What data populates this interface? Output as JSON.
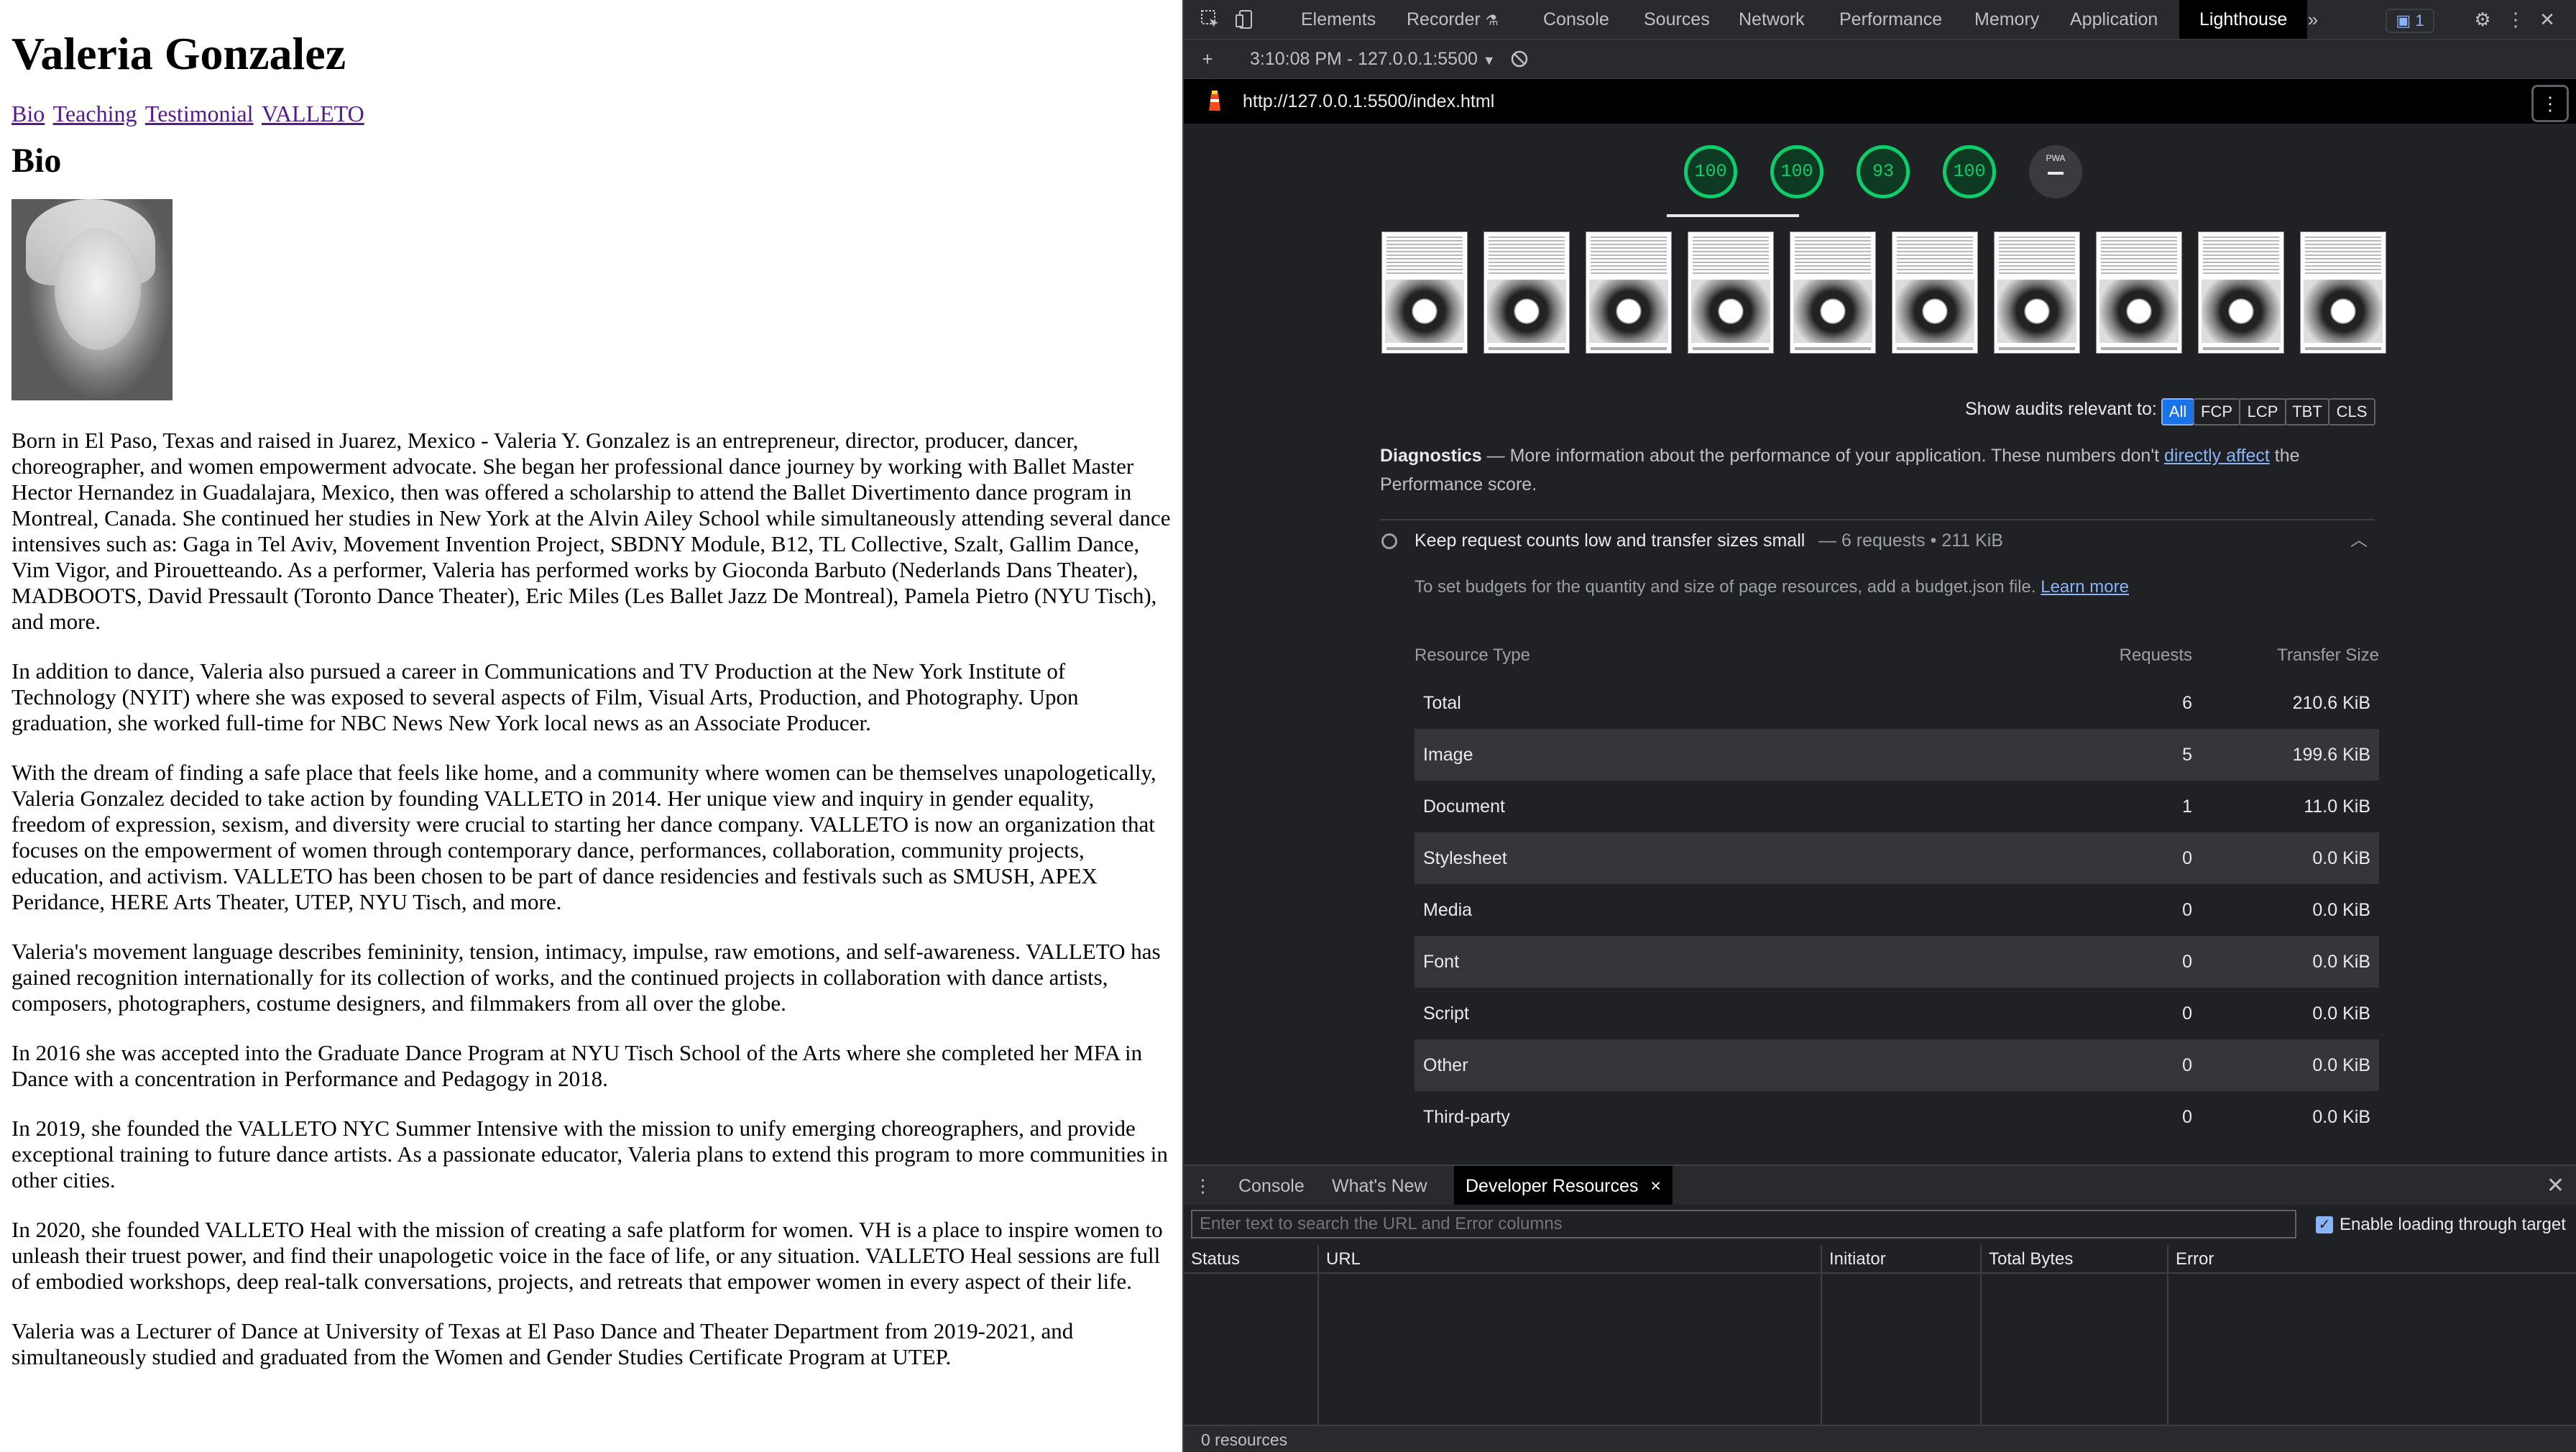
{
  "page": {
    "title": "Valeria Gonzalez",
    "nav": [
      "Bio",
      "Teaching",
      "Testimonial",
      "VALLETO"
    ],
    "section_heading": "Bio",
    "paragraphs": [
      "Born in El Paso, Texas and raised in Juarez, Mexico - Valeria Y. Gonzalez is an entrepreneur, director, producer, dancer, choreographer, and women empowerment advocate. She began her professional dance journey by working with Ballet Master Hector Hernandez in Guadalajara, Mexico, then was offered a scholarship to attend the Ballet Divertimento dance program in Montreal, Canada. She continued her studies in New York at the Alvin Ailey School while simultaneously attending several dance intensives such as: Gaga in Tel Aviv, Movement Invention Project, SBDNY Module, B12, TL Collective, Szalt, Gallim Dance, Vim Vigor, and Pirouetteando. As a performer, Valeria has performed works by Gioconda Barbuto (Nederlands Dans Theater), MADBOOTS, David Pressault (Toronto Dance Theater), Eric Miles (Les Ballet Jazz De Montreal), Pamela Pietro (NYU Tisch), and more.",
      "In addition to dance, Valeria also pursued a career in Communications and TV Production at the New York Institute of Technology (NYIT) where she was exposed to several aspects of Film, Visual Arts, Production, and Photography. Upon graduation, she worked full-time for NBC News New York local news as an Associate Producer.",
      "With the dream of finding a safe place that feels like home, and a community where women can be themselves unapologetically, Valeria Gonzalez decided to take action by founding VALLETO in 2014. Her unique view and inquiry in gender equality, freedom of expression, sexism, and diversity were crucial to starting her dance company. VALLETO is now an organization that focuses on the empowerment of women through contemporary dance, performances, collaboration, community projects, education, and activism. VALLETO has been chosen to be part of dance residencies and festivals such as SMUSH, APEX Peridance, HERE Arts Theater, UTEP, NYU Tisch, and more.",
      "Valeria's movement language describes femininity, tension, intimacy, impulse, raw emotions, and self-awareness. VALLETO has gained recognition internationally for its collection of works, and the continued projects in collaboration with dance artists, composers, photographers, costume designers, and filmmakers from all over the globe.",
      "In 2016 she was accepted into the Graduate Dance Program at NYU Tisch School of the Arts where she completed her MFA in Dance with a concentration in Performance and Pedagogy in 2018.",
      "In 2019, she founded the VALLETO NYC Summer Intensive with the mission to unify emerging choreographers, and provide exceptional training to future dance artists. As a passionate educator, Valeria plans to extend this program to more communities in other cities.",
      "In 2020, she founded VALLETO Heal with the mission of creating a safe platform for women. VH is a place to inspire women to unleash their truest power, and find their unapologetic voice in the face of life, or any situation. VALLETO Heal sessions are full of embodied workshops, deep real-talk conversations, projects, and retreats that empower women in every aspect of their life.",
      "Valeria was a Lecturer of Dance at University of Texas at El Paso Dance and Theater Department from 2019-2021, and simultaneously studied and graduated from the Women and Gender Studies Certificate Program at UTEP."
    ]
  },
  "devtools": {
    "tabs": [
      "Elements",
      "Recorder",
      "Console",
      "Sources",
      "Network",
      "Performance",
      "Memory",
      "Application",
      "Lighthouse"
    ],
    "active_tab": "Lighthouse",
    "issues_count": "1",
    "report_time": "3:10:08 PM - 127.0.0.1:5500",
    "url": "http://127.0.0.1:5500/index.html",
    "scores": [
      "100",
      "100",
      "93",
      "100"
    ],
    "pwa_label": "PWA",
    "show_audits_label": "Show audits relevant to:",
    "filter_chips": [
      "All",
      "FCP",
      "LCP",
      "TBT",
      "CLS"
    ],
    "diagnostics": {
      "title": "Diagnostics",
      "dash": "—",
      "text_before": "More information about the performance of your application. These numbers don't",
      "link": "directly affect",
      "text_after": "the Performance score."
    },
    "audit": {
      "title": "Keep request counts low and transfer sizes small",
      "summary": "— 6 requests • 211 KiB",
      "budget_text": "To set budgets for the quantity and size of page resources, add a budget.json file.",
      "learn_more": "Learn more",
      "columns": [
        "Resource Type",
        "Requests",
        "Transfer Size"
      ],
      "rows": [
        {
          "type": "Total",
          "requests": "6",
          "size": "210.6 KiB"
        },
        {
          "type": "Image",
          "requests": "5",
          "size": "199.6 KiB"
        },
        {
          "type": "Document",
          "requests": "1",
          "size": "11.0 KiB"
        },
        {
          "type": "Stylesheet",
          "requests": "0",
          "size": "0.0 KiB"
        },
        {
          "type": "Media",
          "requests": "0",
          "size": "0.0 KiB"
        },
        {
          "type": "Font",
          "requests": "0",
          "size": "0.0 KiB"
        },
        {
          "type": "Script",
          "requests": "0",
          "size": "0.0 KiB"
        },
        {
          "type": "Other",
          "requests": "0",
          "size": "0.0 KiB"
        },
        {
          "type": "Third-party",
          "requests": "0",
          "size": "0.0 KiB"
        }
      ]
    },
    "drawer": {
      "tabs": [
        "Console",
        "What's New",
        "Developer Resources"
      ],
      "active_tab": "Developer Resources",
      "filter_placeholder": "Enter text to search the URL and Error columns",
      "checkbox_label": "Enable loading through target",
      "columns": [
        "Status",
        "URL",
        "Initiator",
        "Total Bytes",
        "Error"
      ],
      "status": "0 resources"
    }
  }
}
